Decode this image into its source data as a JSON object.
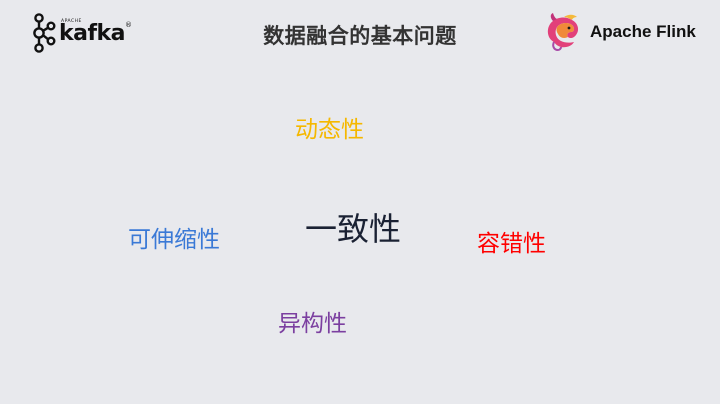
{
  "header": {
    "left_logo": {
      "apache_label": "APACHE",
      "wordmark": "kafka",
      "registered": "®",
      "icon": "kafka-icon"
    },
    "title": "数据融合的基本问题",
    "right_logo": {
      "wordmark": "Apache Flink",
      "icon": "flink-squirrel-icon"
    }
  },
  "concepts": {
    "dynamic": "动态性",
    "consistency": "一致性",
    "scalability": "可伸缩性",
    "fault_tolerance": "容错性",
    "heterogeneity": "异构性"
  },
  "colors": {
    "background": "#e8e9ed",
    "dynamic": "#f5b800",
    "consistency": "#1a2133",
    "scalability": "#3a79d6",
    "fault_tolerance": "#ff0000",
    "heterogeneity": "#7b3fa0"
  }
}
